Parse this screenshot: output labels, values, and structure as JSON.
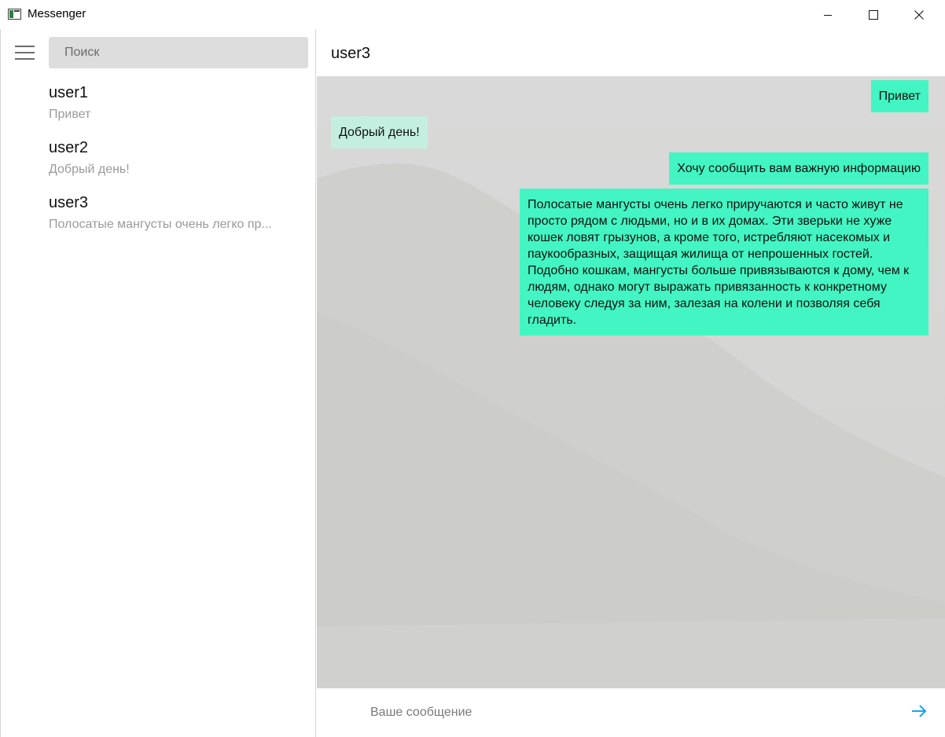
{
  "window": {
    "title": "Messenger",
    "controls": [
      "minimize",
      "maximize",
      "close"
    ]
  },
  "sidebar": {
    "search_placeholder": "Поиск",
    "contacts": [
      {
        "name": "user1",
        "preview": "Привет"
      },
      {
        "name": "user2",
        "preview": "Добрый день!"
      },
      {
        "name": "user3",
        "preview": "Полосатые мангусты очень легко пр..."
      }
    ]
  },
  "chat": {
    "title": "user3",
    "messages": [
      {
        "direction": "out",
        "text": "Привет"
      },
      {
        "direction": "in",
        "text": "Добрый день!"
      },
      {
        "direction": "out",
        "text": "Хочу сообщить вам важную информацию"
      },
      {
        "direction": "out",
        "text": "Полосатые мангусты очень легко приручаются и часто живут не просто рядом с людьми, но и в их домах. Эти зверьки не хуже кошек ловят грызунов, а кроме того, истребляют насекомых и паукообразных, защищая жилища от непрошенных гостей. Подобно кошкам, мангусты больше привязываются к дому, чем к людям, однако могут выражать привязанность к конкретному человеку следуя за ним, залезая на колени и позволяя себя гладить."
      }
    ],
    "composer_placeholder": "Ваше сообщение"
  },
  "colors": {
    "outgoing_bubble": "#43f5c2",
    "incoming_bubble": "#c4efe0",
    "send_icon": "#1aa3e8",
    "search_bg": "#dddddd"
  },
  "icons": {
    "menu": "hamburger-icon",
    "send": "arrow-right-icon"
  }
}
